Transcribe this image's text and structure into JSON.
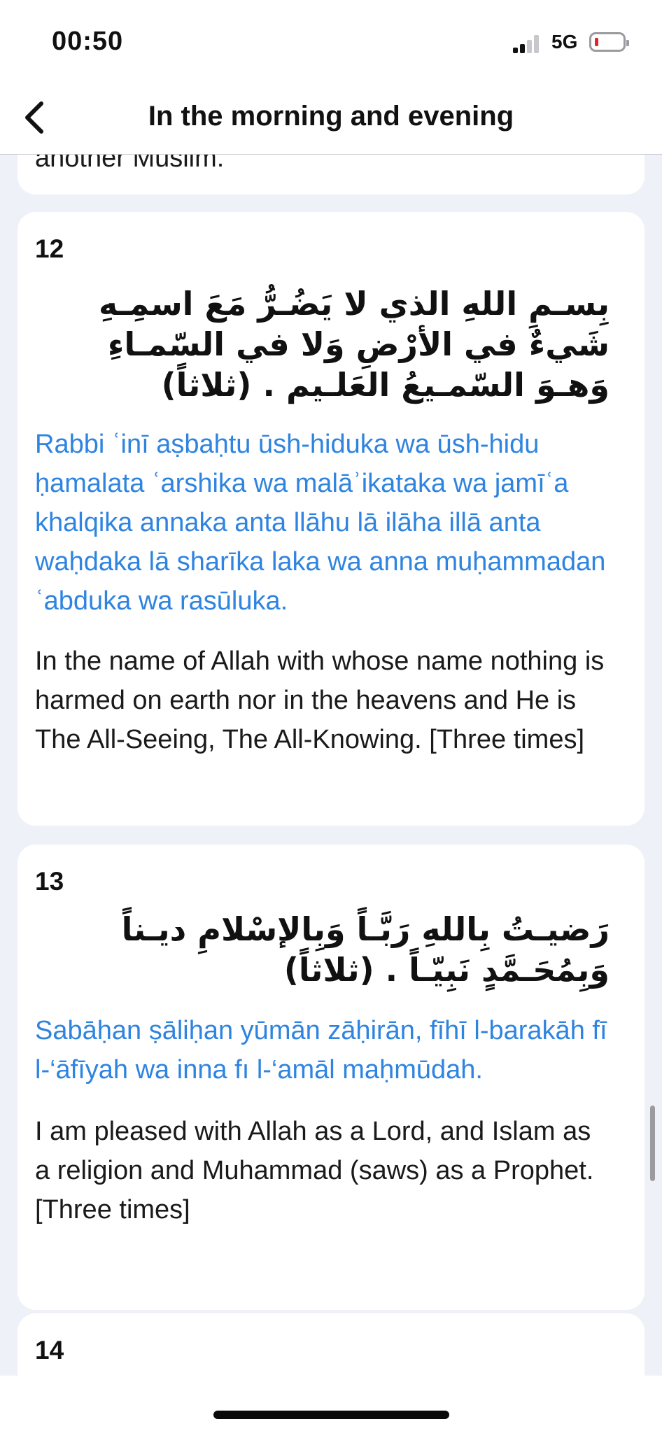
{
  "status_bar": {
    "time": "00:50",
    "network": "5G"
  },
  "nav": {
    "title": "In the morning and evening"
  },
  "prev_card": {
    "tail_text": "another Muslim."
  },
  "cards": [
    {
      "number": "12",
      "arabic": "بِسـمِ اللهِ الذي لا يَضُـرُّ مَعَ اسمِـهِ شَيءٌ في الأرْضِ وَلا في السّمـاءِ وَهـوَ السّمـيعُ العَلـيم . (ثلاثاً)",
      "transliteration": "Rabbi ʿinī aṣbaḥtu ūsh-hiduka wa ūsh-hidu ḥamalata ʿarshika wa malāʾikataka wa jamīʿa khalqika annaka anta llāhu lā ilāha illā anta waḥdaka lā sharīka laka wa anna muḥammadan ʿabduka wa rasūluka.",
      "translation": "In the name of Allah with whose name nothing is harmed on earth nor in the heavens and He is The All-Seeing, The All-Knowing. [Three times]"
    },
    {
      "number": "13",
      "arabic": "رَضيـتُ بِاللهِ رَبَّـاً وَبِالإسْلامِ ديـناً وَبِمُحَـمَّدٍ نَبِيّـاً . (ثلاثاً)",
      "transliteration": "Sabāḥan ṣāliḥan yūmān zāḥirān, fīhī l-barakāh fī l-‘āfīyah wa inna fı l-‘amāl maḥmūdah.",
      "translation": "I am pleased with Allah as a Lord, and Islam as a religion and Muhammad  (saws) as a Prophet. [Three times]"
    },
    {
      "number": "14"
    }
  ],
  "icons": {
    "back": "chevron-left-icon",
    "signal": "cellular-signal-icon",
    "battery": "battery-icon"
  },
  "colors": {
    "transliteration": "#2f84e0",
    "battery_low": "#e5242a",
    "background": "#eef1f7"
  }
}
